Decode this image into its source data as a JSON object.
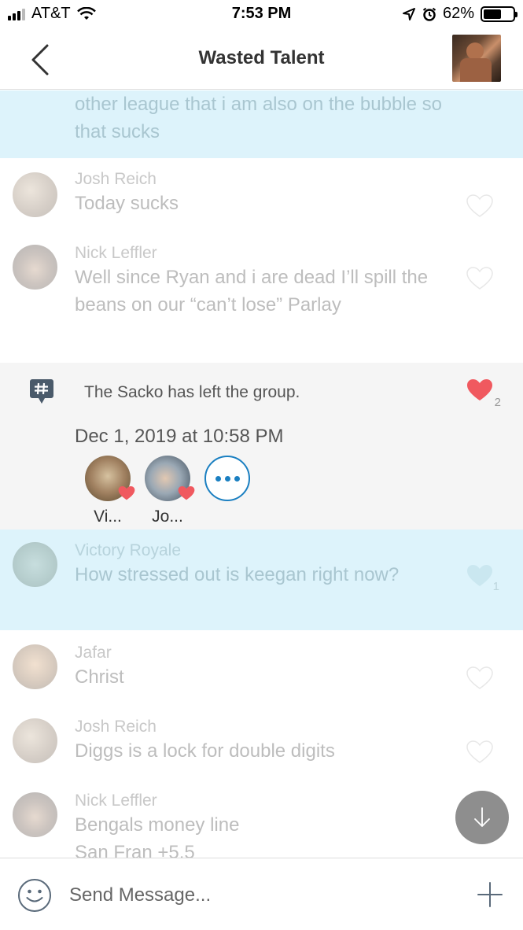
{
  "status_bar": {
    "carrier": "AT&T",
    "time": "7:53 PM",
    "battery": "62%",
    "battery_level": 0.62
  },
  "nav": {
    "title": "Wasted Talent",
    "back_icon": "chevron-left-icon",
    "avatar_icon": "group-avatar"
  },
  "feed": {
    "top_partial_text": "other league that i am also on the bubble so that sucks",
    "messages": [
      {
        "name": "Josh Reich",
        "text": "Today sucks"
      },
      {
        "name": "Nick Leffler",
        "text": "Well since Ryan and i are dead I’ll spill the beans on our “can’t lose” Parlay"
      }
    ],
    "system": {
      "text": "The Sacko has left the group.",
      "like_count": "2",
      "date": "Dec 1, 2019 at 10:58 PM",
      "likers": [
        {
          "name": "Vi..."
        },
        {
          "name": "Jo..."
        }
      ]
    },
    "messages_after": [
      {
        "name": "Victory Royale",
        "text": "How stressed out is keegan right now?",
        "like_count": "1"
      },
      {
        "name": "Jafar",
        "text": "Christ"
      },
      {
        "name": "Josh Reich",
        "text": "Diggs is a lock for double digits"
      },
      {
        "name": "Nick Leffler",
        "text": "Bengals money line",
        "text2": "San Fran +5.5"
      }
    ]
  },
  "composer": {
    "placeholder": "Send Message...",
    "emoji_icon": "smiley-icon",
    "plus_icon": "plus-icon"
  },
  "colors": {
    "accent": "#1a7fc1",
    "heart": "#f0595f",
    "highlight": "#ddf3fb"
  }
}
